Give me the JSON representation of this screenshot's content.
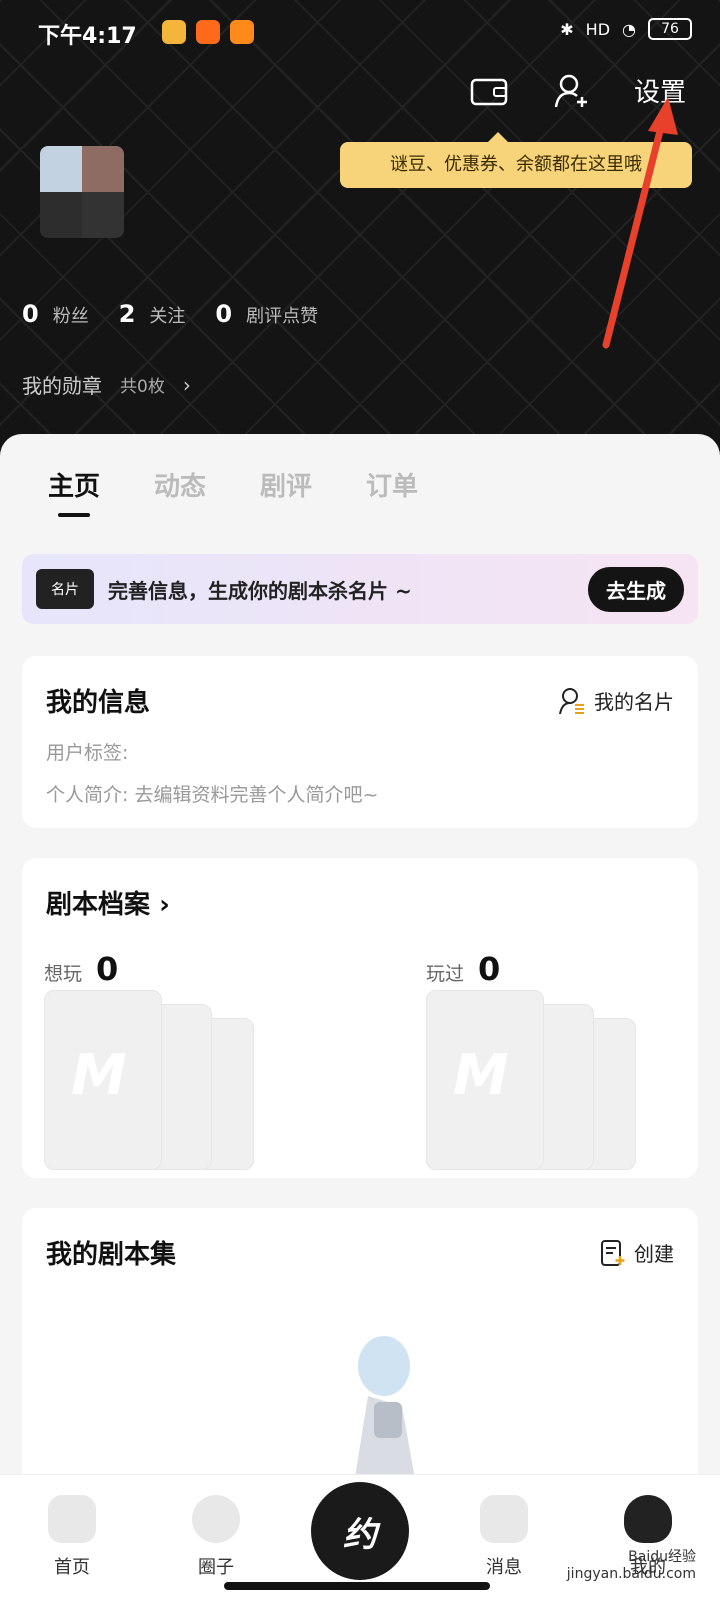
{
  "status_bar": {
    "time": "下午4:17",
    "battery": "76",
    "signal_label": "HD"
  },
  "header": {
    "settings_label": "设置",
    "tooltip": "谜豆、优惠券、余额都在这里哦"
  },
  "profile": {
    "stats": [
      {
        "num": "0",
        "label": "粉丝"
      },
      {
        "num": "2",
        "label": "关注"
      },
      {
        "num": "0",
        "label": "剧评点赞"
      }
    ],
    "badge_label": "我的勋章",
    "badge_count": "共0枚"
  },
  "tabs": [
    "主页",
    "动态",
    "剧评",
    "订单"
  ],
  "banner": {
    "icon_text": "名片",
    "text": "完善信息，生成你的剧本杀名片 ~",
    "button": "去生成"
  },
  "my_info": {
    "title": "我的信息",
    "card_link": "我的名片",
    "user_tags": "用户标签:",
    "bio": "个人简介: 去编辑资料完善个人简介吧~"
  },
  "archive": {
    "title": "剧本档案",
    "want_label": "想玩",
    "want_count": "0",
    "played_label": "玩过",
    "played_count": "0",
    "thumb_mark": "M"
  },
  "collections": {
    "title": "我的剧本集",
    "create_label": "创建"
  },
  "tabbar": {
    "items": [
      {
        "label": "首页"
      },
      {
        "label": "圈子"
      },
      {
        "label": "消息"
      },
      {
        "label": "我的"
      }
    ],
    "center_label": "约"
  },
  "watermark": {
    "line1": "Baidu经验",
    "line2": "jingyan.baidu.com"
  },
  "colors": {
    "accent_tooltip": "#f7d47a",
    "dark_bg": "#141414",
    "arrow": "#e8412b"
  }
}
